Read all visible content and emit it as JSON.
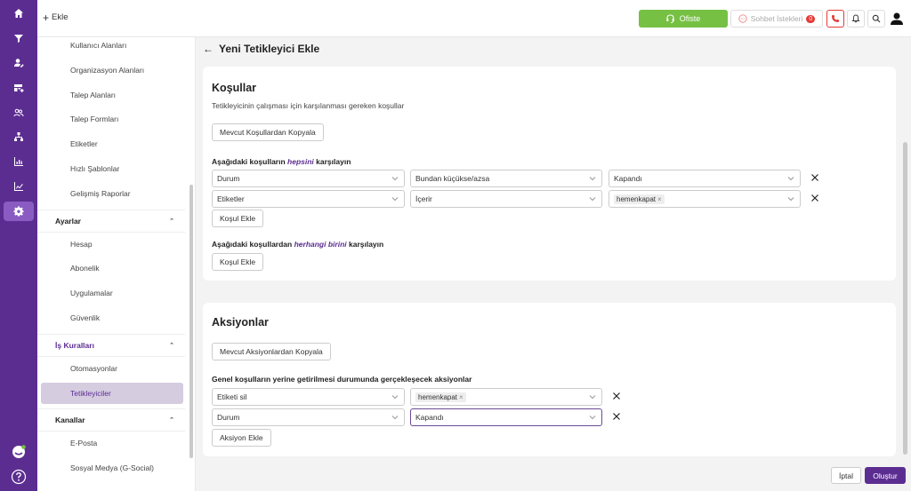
{
  "topbar": {
    "add_label": "Ekle",
    "status_label": "Ofiste",
    "chat_requests_label": "Sohbet İstekleri",
    "chat_requests_count": "0",
    "colors": {
      "status": "#76c043",
      "brand": "#5c2d91",
      "alert": "#e53935"
    }
  },
  "rail": {
    "icons": [
      "home-icon",
      "filter-icon",
      "user-edit-icon",
      "table-add-icon",
      "contacts-icon",
      "hierarchy-icon",
      "chart-icon",
      "bar-chart-icon",
      "settings-icon"
    ],
    "active": "settings-icon",
    "bottom_icons": [
      "chat-bot-icon",
      "help-icon"
    ]
  },
  "sidebar": {
    "top_items": [
      "Kullanıcı Alanları",
      "Organizasyon Alanları",
      "Talep Alanları",
      "Talep Formları",
      "Etiketler",
      "Hızlı Şablonlar",
      "Gelişmiş Raporlar"
    ],
    "groups": [
      {
        "label": "Ayarlar",
        "items": [
          "Hesap",
          "Abonelik",
          "Uygulamalar",
          "Güvenlik"
        ]
      },
      {
        "label": "İş Kuralları",
        "items": [
          "Otomasyonlar",
          "Tetikleyiciler"
        ]
      },
      {
        "label": "Kanallar",
        "items": [
          "E-Posta",
          "Sosyal Medya (G-Social)"
        ]
      }
    ],
    "active_item": "Tetikleyiciler"
  },
  "page": {
    "title": "Yeni Tetikleyici Ekle"
  },
  "conditions": {
    "title": "Koşullar",
    "subtitle": "Tetikleyicinin çalışması için karşılanması gereken koşullar",
    "copy_button": "Mevcut Koşullardan Kopyala",
    "all_label_pre": "Aşağıdaki koşulların ",
    "all_label_em": "hepsini",
    "all_label_post": " karşılayın",
    "all_rows": [
      {
        "field": "Durum",
        "operator": "Bundan küçükse/azsa",
        "value": "Kapandı"
      },
      {
        "field": "Etiketler",
        "operator": "İçerir",
        "value_tag": "hemenkapat"
      }
    ],
    "add_button": "Koşul Ekle",
    "any_label_pre": "Aşağıdaki koşullardan ",
    "any_label_em": "herhangi birini",
    "any_label_post": " karşılayın",
    "any_add_button": "Koşul Ekle"
  },
  "actions": {
    "title": "Aksiyonlar",
    "copy_button": "Mevcut Aksiyonlardan Kopyala",
    "label": "Genel koşulların yerine getirilmesi durumunda gerçekleşecek aksiyonlar",
    "rows": [
      {
        "field": "Etiketi sil",
        "value_tag": "hemenkapat"
      },
      {
        "field": "Durum",
        "value": "Kapandı"
      }
    ],
    "add_button": "Aksiyon Ekle"
  },
  "footer": {
    "cancel": "İptal",
    "create": "Oluştur"
  }
}
